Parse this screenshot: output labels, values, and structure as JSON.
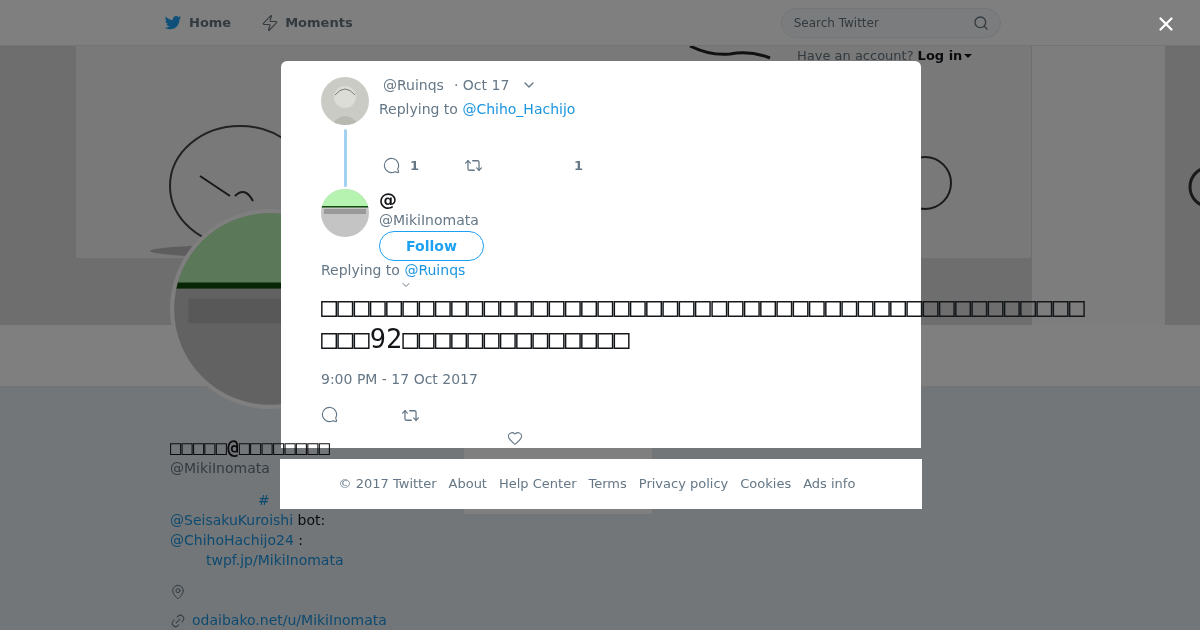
{
  "nav": {
    "items": [
      {
        "label": "Home"
      },
      {
        "label": "Moments"
      }
    ],
    "search": {
      "placeholder": "Search Twitter"
    },
    "account_prompt": "Have an account?",
    "login": "Log in"
  },
  "profile": {
    "name": "□□□□□@□□□□□□□□",
    "handle": "@MikiInomata",
    "bio": [
      [
        {
          "kind": "link",
          "text": "#"
        }
      ],
      [
        {
          "kind": "link",
          "text": "@SeisakuKuroishi"
        },
        {
          "kind": "text",
          "text": " bot:"
        }
      ],
      [
        {
          "kind": "link",
          "text": "@ChihoHachijo24"
        },
        {
          "kind": "text",
          "text": " :"
        }
      ],
      [
        {
          "kind": "link",
          "text": "twpf.jp/MikiInomata"
        }
      ]
    ],
    "url": "odaibako.net/u/MikiInomata"
  },
  "dialog": {
    "tweets": [
      {
        "handle": "@Ruinqs",
        "time": "· Oct 17",
        "replying_label": "Replying to",
        "replying_to": "@Chiho_Hachijo",
        "replies": "1",
        "likes": "1"
      },
      {
        "name": "@",
        "handle": "@MikiInomata",
        "follow": "Follow",
        "replying_label": "Replying to",
        "replying_to": "@Ruinqs",
        "text": "□□□□□□□□□□□□□□□□□□□□□□□□□□□□□□□□□□□□□□□□□□□□□□□\n□□□92□□□□□□□□□□□□□□",
        "timestamp": "9:00 PM - 17 Oct 2017"
      }
    ],
    "footer": [
      "© 2017 Twitter",
      "About",
      "Help Center",
      "Terms",
      "Privacy policy",
      "Cookies",
      "Ads info"
    ]
  }
}
